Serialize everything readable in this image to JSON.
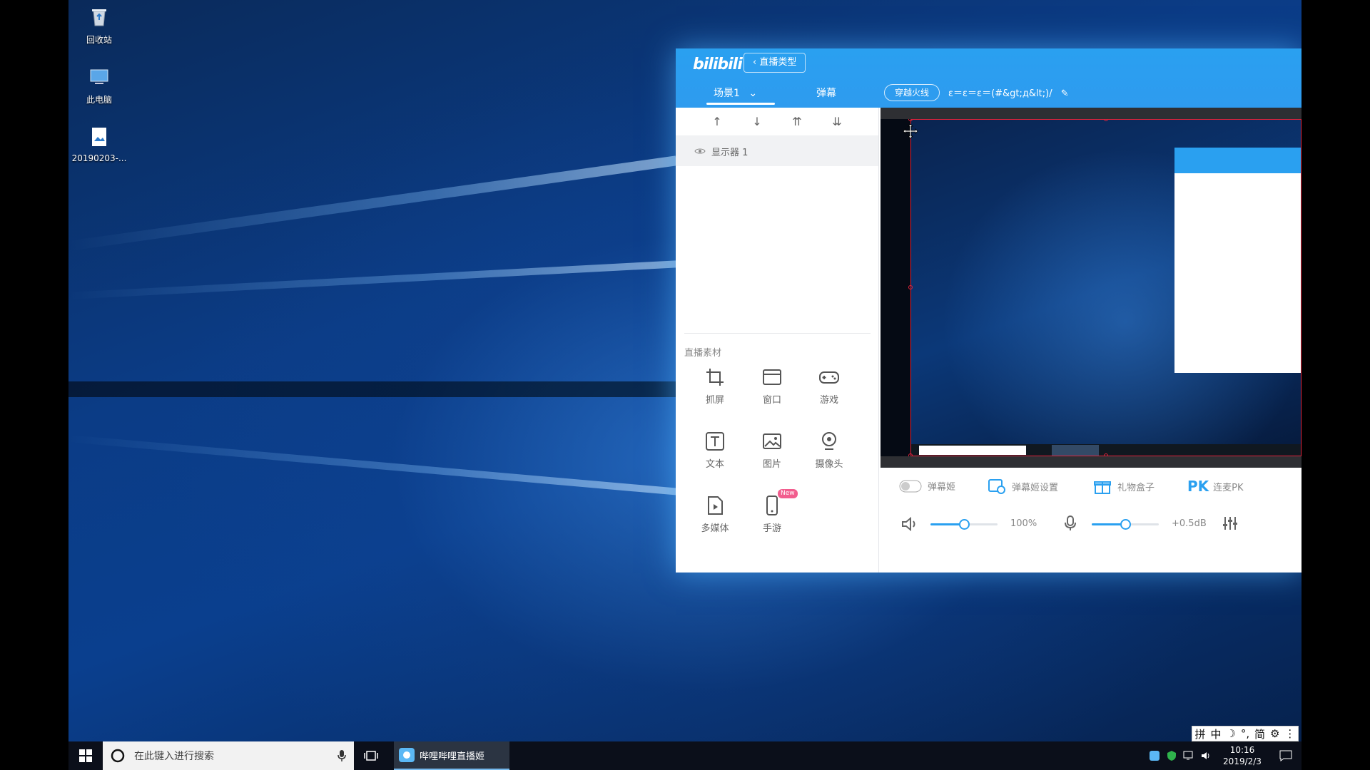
{
  "desktop": {
    "icons": [
      {
        "label": "回收站"
      },
      {
        "label": "此电脑"
      },
      {
        "label": "20190203-..."
      }
    ]
  },
  "app": {
    "logo": "bilibili",
    "back_button": "‹ 直播类型",
    "tabs": {
      "scene": "场景1",
      "danmu": "弹幕"
    },
    "fire_button": "穿越火线",
    "room_title": "ε＝ε＝ε＝(#&gt;д&lt;)/",
    "order_tools": [
      "↑",
      "↓",
      "⇈",
      "⇊"
    ],
    "source_item": "显示器 1",
    "materials_title": "直播素材",
    "materials": [
      {
        "label": "抓屏",
        "icon": "crop-icon"
      },
      {
        "label": "窗口",
        "icon": "window-icon"
      },
      {
        "label": "游戏",
        "icon": "gamepad-icon"
      },
      {
        "label": "文本",
        "icon": "text-icon"
      },
      {
        "label": "图片",
        "icon": "image-icon"
      },
      {
        "label": "摄像头",
        "icon": "camera-icon"
      },
      {
        "label": "多媒体",
        "icon": "media-icon"
      },
      {
        "label": "手游",
        "icon": "mobile-icon",
        "badge": "New"
      }
    ],
    "controls": {
      "danmaku_toggle": "弹幕姬",
      "danmaku_settings": "弹幕姬设置",
      "gift_box": "礼物盒子",
      "pk_icon": "PK",
      "pk": "连麦PK",
      "volume_value": "100%",
      "volume_level": 0.5,
      "mic_value": "+0.5dB",
      "mic_level": 0.5
    }
  },
  "taskbar": {
    "search_placeholder": "在此键入进行搜索",
    "task_app": "哔哩哔哩直播姬",
    "ime": [
      "拼",
      "中",
      "☽",
      "°,",
      "简",
      "⚙",
      "⋮"
    ],
    "time": "10:16",
    "date": "2019/2/3"
  },
  "colors": {
    "accent": "#2aa0f0",
    "selection": "#e0233a",
    "badge": "#f25d8e"
  }
}
